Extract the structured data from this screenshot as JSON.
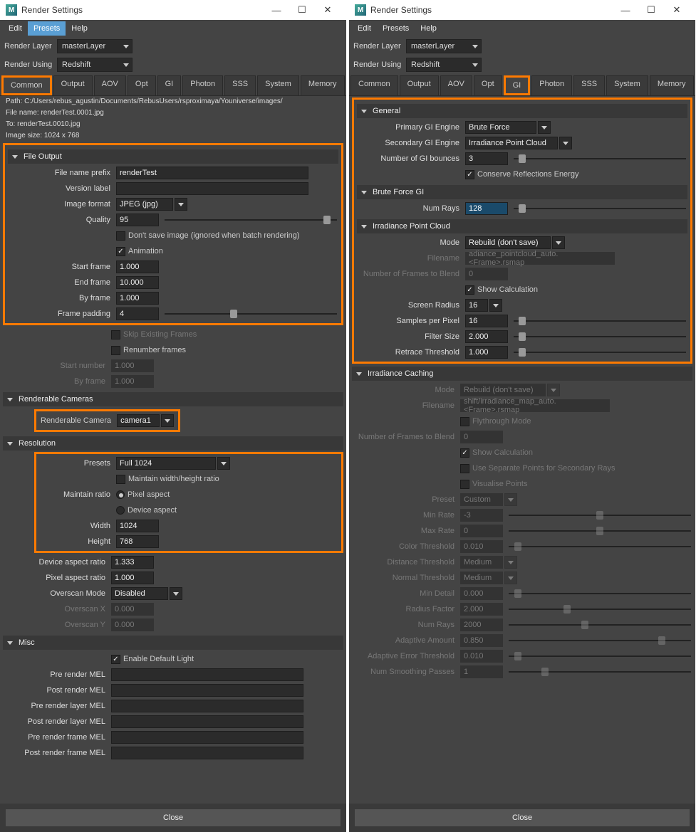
{
  "leftWindow": {
    "title": "Render Settings",
    "menubar": [
      "Edit",
      "Presets",
      "Help"
    ],
    "renderLayer": {
      "label": "Render Layer",
      "value": "masterLayer"
    },
    "renderUsing": {
      "label": "Render Using",
      "value": "Redshift"
    },
    "tabs": [
      "Common",
      "Output",
      "AOV",
      "Opt",
      "GI",
      "Photon",
      "SSS",
      "System",
      "Memory"
    ],
    "activeTab": "Common",
    "info": {
      "path": "Path: C:/Users/rebus_agustin/Documents/RebusUsers/rsproximaya/Youniverse/images/",
      "filename": "File name:  renderTest.0001.jpg",
      "to": "To:           renderTest.0010.jpg",
      "imagesize": "Image size: 1024 x 768"
    },
    "sections": {
      "fileOutput": {
        "title": "File Output",
        "filenamePrefix": {
          "label": "File name prefix",
          "value": "renderTest"
        },
        "versionLabel": {
          "label": "Version label",
          "value": ""
        },
        "imageFormat": {
          "label": "Image format",
          "value": "JPEG (jpg)"
        },
        "quality": {
          "label": "Quality",
          "value": "95"
        },
        "dontSave": {
          "label": "Don't save image (ignored when batch rendering)",
          "checked": false
        },
        "animation": {
          "label": "Animation",
          "checked": true
        },
        "startFrame": {
          "label": "Start frame",
          "value": "1.000"
        },
        "endFrame": {
          "label": "End frame",
          "value": "10.000"
        },
        "byFrame": {
          "label": "By frame",
          "value": "1.000"
        },
        "framePadding": {
          "label": "Frame padding",
          "value": "4"
        }
      },
      "skipExisting": {
        "label": "Skip Existing Frames",
        "checked": false
      },
      "renumber": {
        "label": "Renumber frames",
        "checked": false
      },
      "startNumber": {
        "label": "Start number",
        "value": "1.000"
      },
      "byFrame2": {
        "label": "By frame",
        "value": "1.000"
      },
      "renderableCameras": {
        "title": "Renderable Cameras",
        "camera": {
          "label": "Renderable Camera",
          "value": "camera1"
        }
      },
      "resolution": {
        "title": "Resolution",
        "presets": {
          "label": "Presets",
          "value": "Full 1024"
        },
        "maintainRatioCb": {
          "label": "Maintain width/height ratio",
          "checked": false
        },
        "maintainRatio": {
          "label": "Maintain ratio",
          "pixelAspect": "Pixel aspect",
          "deviceAspect": "Device aspect"
        },
        "width": {
          "label": "Width",
          "value": "1024"
        },
        "height": {
          "label": "Height",
          "value": "768"
        },
        "deviceAspectRatio": {
          "label": "Device aspect ratio",
          "value": "1.333"
        },
        "pixelAspectRatio": {
          "label": "Pixel aspect ratio",
          "value": "1.000"
        },
        "overscanMode": {
          "label": "Overscan Mode",
          "value": "Disabled"
        },
        "overscanX": {
          "label": "Overscan X",
          "value": "0.000"
        },
        "overscanY": {
          "label": "Overscan Y",
          "value": "0.000"
        }
      },
      "misc": {
        "title": "Misc",
        "enableDefaultLight": {
          "label": "Enable Default Light",
          "checked": true
        },
        "preRenderMEL": {
          "label": "Pre render MEL",
          "value": ""
        },
        "postRenderMEL": {
          "label": "Post render MEL",
          "value": ""
        },
        "preRenderLayerMEL": {
          "label": "Pre render layer MEL",
          "value": ""
        },
        "postRenderLayerMEL": {
          "label": "Post render layer MEL",
          "value": ""
        },
        "preRenderFrameMEL": {
          "label": "Pre render frame MEL",
          "value": ""
        },
        "postRenderFrameMEL": {
          "label": "Post render frame MEL",
          "value": ""
        }
      }
    },
    "closeBtn": "Close"
  },
  "rightWindow": {
    "title": "Render Settings",
    "menubar": [
      "Edit",
      "Presets",
      "Help"
    ],
    "renderLayer": {
      "label": "Render Layer",
      "value": "masterLayer"
    },
    "renderUsing": {
      "label": "Render Using",
      "value": "Redshift"
    },
    "tabs": [
      "Common",
      "Output",
      "AOV",
      "Opt",
      "GI",
      "Photon",
      "SSS",
      "System",
      "Memory"
    ],
    "activeTab": "GI",
    "sections": {
      "general": {
        "title": "General",
        "primaryGI": {
          "label": "Primary GI Engine",
          "value": "Brute Force"
        },
        "secondaryGI": {
          "label": "Secondary GI Engine",
          "value": "Irradiance Point Cloud"
        },
        "numBounces": {
          "label": "Number of GI bounces",
          "value": "3"
        },
        "conserve": {
          "label": "Conserve Reflections Energy",
          "checked": true
        }
      },
      "bruteForce": {
        "title": "Brute Force GI",
        "numRays": {
          "label": "Num Rays",
          "value": "128"
        }
      },
      "ipc": {
        "title": "Irradiance Point Cloud",
        "mode": {
          "label": "Mode",
          "value": "Rebuild (don't save)"
        },
        "filename": {
          "label": "Filename",
          "value": "adiance_pointcloud_auto.<Frame>.rsmap"
        },
        "framesBlend": {
          "label": "Number of Frames to Blend",
          "value": "0"
        },
        "showCalc": {
          "label": "Show Calculation",
          "checked": true
        },
        "screenRadius": {
          "label": "Screen Radius",
          "value": "16"
        },
        "samplesPerPixel": {
          "label": "Samples per Pixel",
          "value": "16"
        },
        "filterSize": {
          "label": "Filter Size",
          "value": "2.000"
        },
        "retrace": {
          "label": "Retrace Threshold",
          "value": "1.000"
        }
      },
      "ic": {
        "title": "Irradiance Caching",
        "mode": {
          "label": "Mode",
          "value": "Rebuild (don't save)"
        },
        "filename": {
          "label": "Filename",
          "value": "shift/irradiance_map_auto.<Frame>.rsmap"
        },
        "flythrough": {
          "label": "Flythrough Mode",
          "checked": false
        },
        "framesBlend": {
          "label": "Number of Frames to Blend",
          "value": "0"
        },
        "showCalc": {
          "label": "Show Calculation",
          "checked": true
        },
        "separatePoints": {
          "label": "Use Separate Points for Secondary Rays",
          "checked": false
        },
        "visualisePoints": {
          "label": "Visualise Points",
          "checked": false
        },
        "preset": {
          "label": "Preset",
          "value": "Custom"
        },
        "minRate": {
          "label": "Min Rate",
          "value": "-3"
        },
        "maxRate": {
          "label": "Max Rate",
          "value": "0"
        },
        "colorThresh": {
          "label": "Color Threshold",
          "value": "0.010"
        },
        "distThresh": {
          "label": "Distance Threshold",
          "value": "Medium"
        },
        "normalThresh": {
          "label": "Normal Threshold",
          "value": "Medium"
        },
        "minDetail": {
          "label": "Min Detail",
          "value": "0.000"
        },
        "radiusFactor": {
          "label": "Radius Factor",
          "value": "2.000"
        },
        "numRays": {
          "label": "Num Rays",
          "value": "2000"
        },
        "adaptiveAmount": {
          "label": "Adaptive Amount",
          "value": "0.850"
        },
        "adaptiveError": {
          "label": "Adaptive Error Threshold",
          "value": "0.010"
        },
        "numSmoothing": {
          "label": "Num Smoothing Passes",
          "value": "1"
        }
      }
    },
    "closeBtn": "Close"
  }
}
